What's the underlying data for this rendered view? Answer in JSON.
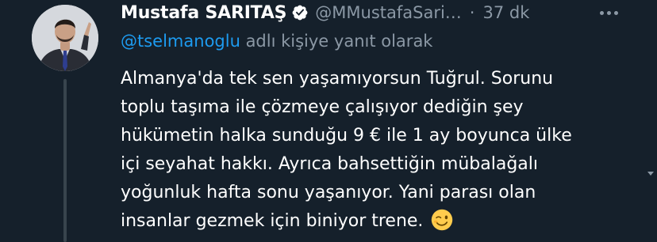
{
  "tweet": {
    "author_name": "Mustafa SARITAŞ",
    "author_handle": "@MMustafaSari…",
    "separator": "·",
    "time_ago": "37 dk",
    "verified": true,
    "reply_to_handle": "@tselmanoglu",
    "reply_to_suffix": " adlı kişiye yanıt olarak",
    "body_lines": [
      "Almanya'da tek sen yaşamıyorsun Tuğrul. Sorunu",
      "toplu taşıma ile çözmeye çalışıyor dediğin şey",
      "hükümetin halka sunduğu 9 € ile 1 ay boyunca ülke",
      "içi seyahat hakkı. Ayrıca bahsettiğin mübalağalı",
      "yoğunluk hafta sonu yaşanıyor. Yani parası olan",
      "insanlar gezmek için biniyor trene."
    ],
    "emoji": "winking-face-emoji"
  },
  "colors": {
    "background": "#15202b",
    "secondary_text": "#8b98a5",
    "accent": "#1d9bf0",
    "thread_line": "#38444d"
  },
  "icons": {
    "verified": "verified-badge-icon",
    "more": "more-dots-icon",
    "scroll": "scroll-down-arrow-icon"
  }
}
